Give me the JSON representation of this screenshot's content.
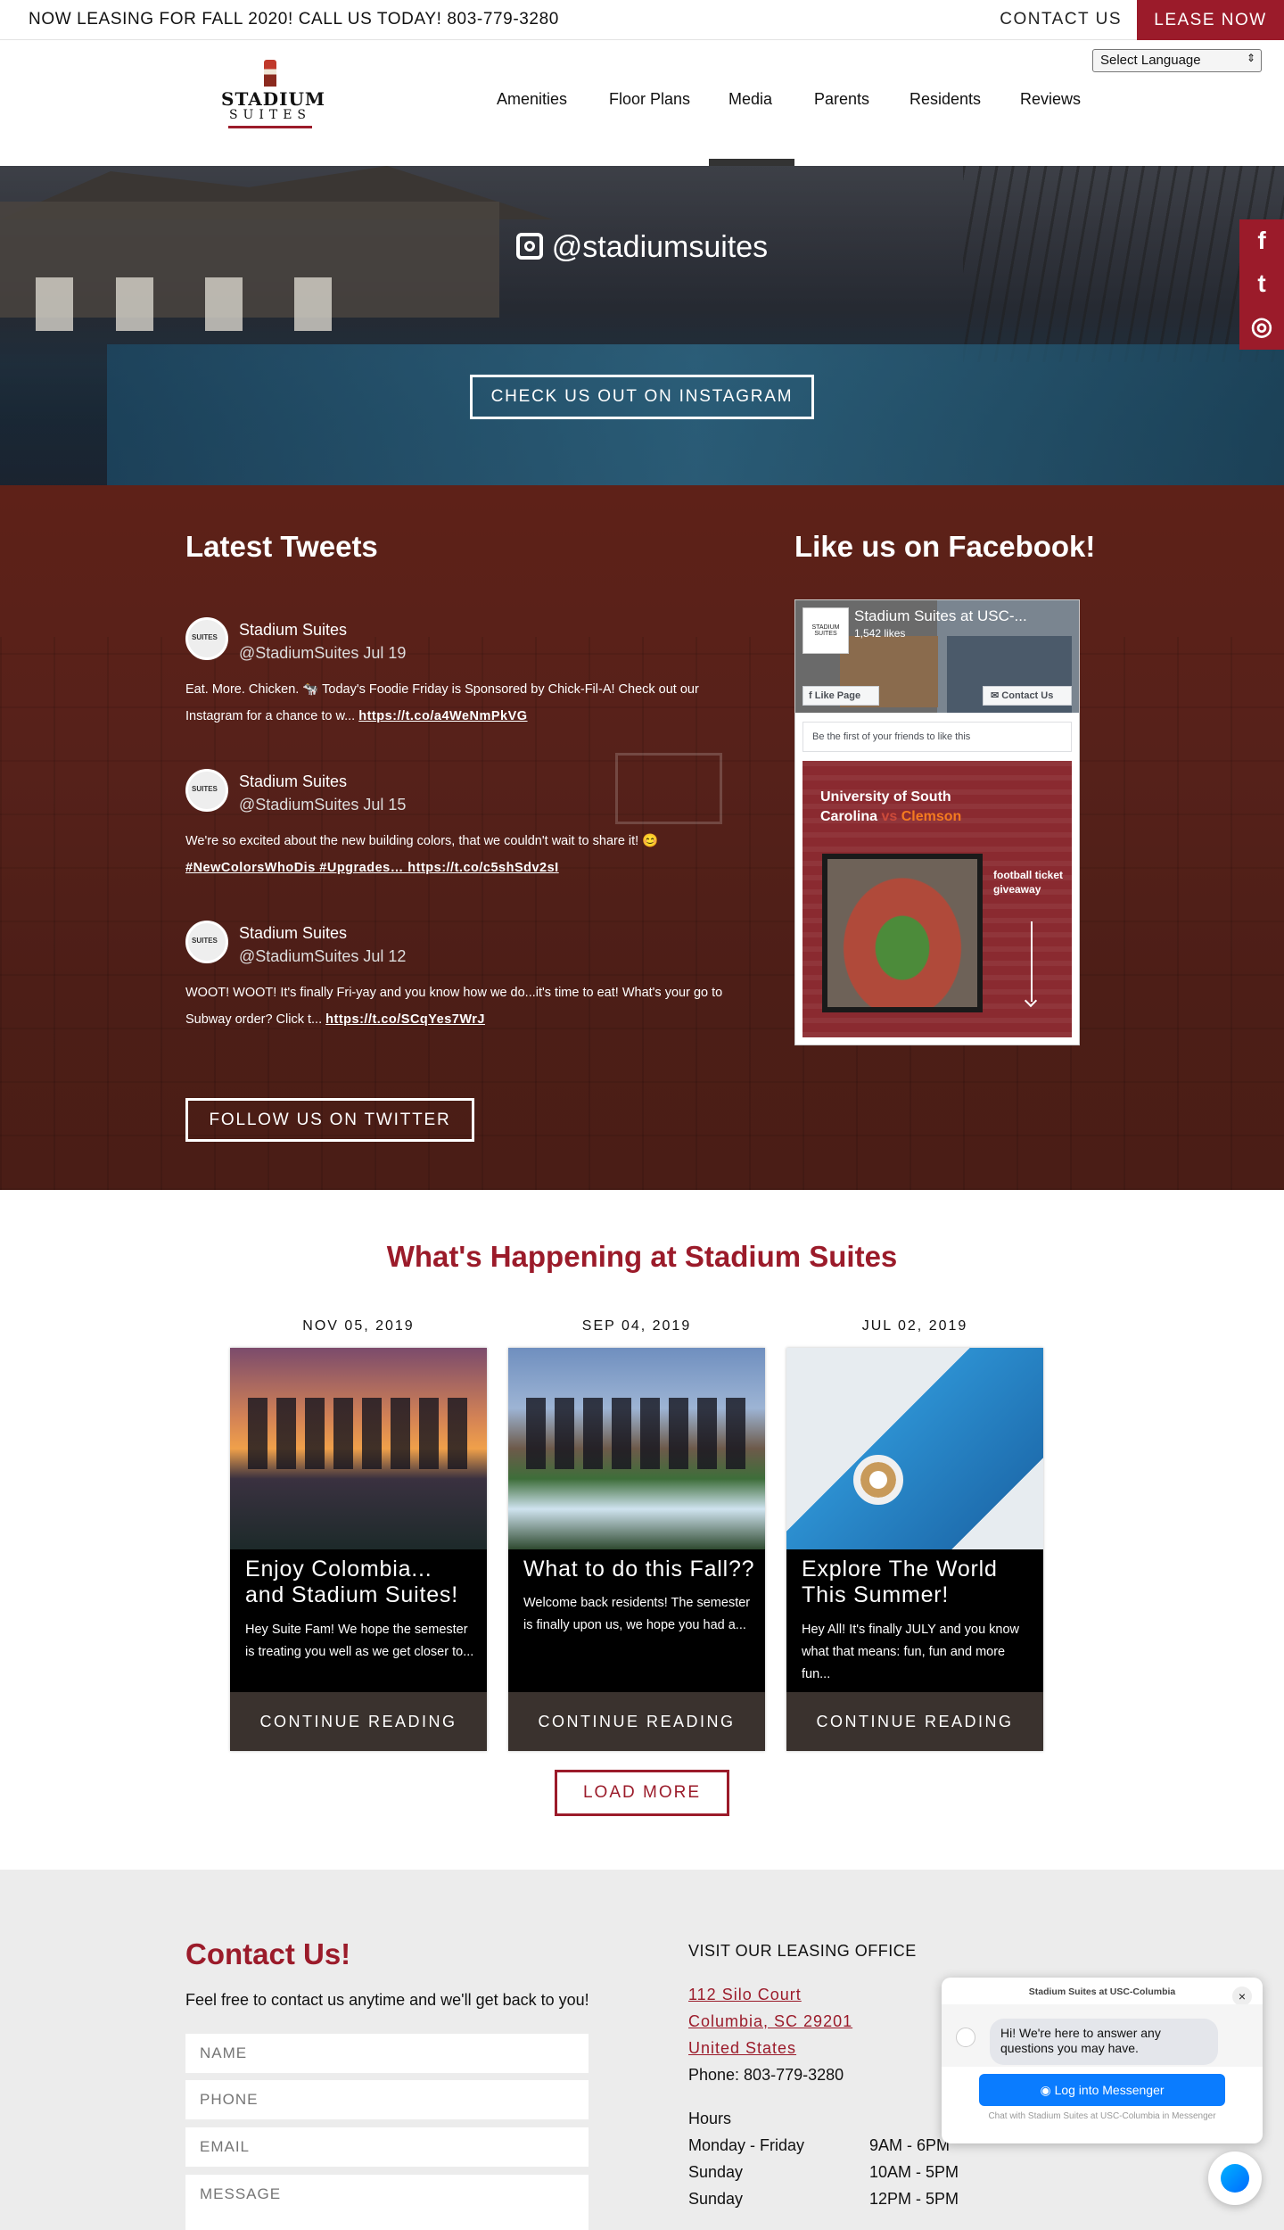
{
  "topbar": {
    "promo": "NOW LEASING FOR FALL 2020! CALL US TODAY! 803-779-3280",
    "contact_label": "CONTACT US",
    "lease_label": "LEASE NOW"
  },
  "header": {
    "language_select": "Select Language",
    "logo_line1": "STADIUM",
    "logo_line2": "SUITES",
    "nav": [
      "Amenities",
      "Floor Plans",
      "Media",
      "Parents",
      "Residents",
      "Reviews"
    ],
    "active_nav": "Media"
  },
  "hero": {
    "instagram_handle": "@stadiumsuites",
    "instagram_button": "CHECK US OUT ON INSTAGRAM"
  },
  "social_tab": {
    "icons": [
      "facebook-icon",
      "twitter-icon",
      "instagram-icon"
    ],
    "glyphs": [
      "f",
      "t",
      "◎"
    ]
  },
  "tweets": {
    "title": "Latest Tweets",
    "items": [
      {
        "name": "Stadium Suites",
        "handle": "@StadiumSuites Jul 19",
        "text": "Eat. More. Chicken. 🐄 Today's Foodie Friday is Sponsored by Chick-Fil-A! Check out our Instagram for a chance to w...",
        "link": "https://t.co/a4WeNmPkVG"
      },
      {
        "name": "Stadium Suites",
        "handle": "@StadiumSuites Jul 15",
        "text": "We're so excited about the new building colors, that we couldn't wait to share it! 😊",
        "link": "#NewColorsWhoDis #Upgrades… https://t.co/c5shSdv2sI"
      },
      {
        "name": "Stadium Suites",
        "handle": "@StadiumSuites Jul 12",
        "text": "WOOT! WOOT! It's finally Fri-yay and you know how we do...it's time to eat! What's your go to Subway order? Click t...",
        "link": "https://t.co/SCqYes7WrJ"
      }
    ],
    "follow_button": "FOLLOW US ON TWITTER"
  },
  "facebook": {
    "title": "Like us on Facebook!",
    "page_name": "Stadium Suites at USC-...",
    "likes": "1,542 likes",
    "like_button": "Like Page",
    "contact_button": "Contact Us",
    "friends_text": "Be the first of your friends to like this",
    "post_line1": "University of South",
    "post_line2a": "Carolina",
    "post_vs": "vs",
    "post_line2b": "Clemson",
    "post_giveaway": "football ticket giveaway",
    "page_logo_text": "STADIUM SUITES"
  },
  "happening": {
    "title": "What's Happening at Stadium Suites",
    "posts": [
      {
        "date": "NOV 05, 2019",
        "title": "Enjoy Colombia... and Stadium Suites!",
        "excerpt": "Hey Suite Fam!  We hope the semester is treating you well as we get closer to...",
        "button": "CONTINUE READING"
      },
      {
        "date": "SEP 04, 2019",
        "title": "What to do this Fall??",
        "excerpt": "Welcome back residents! The semester is finally upon us, we hope you had a...",
        "button": "CONTINUE READING"
      },
      {
        "date": "JUL 02, 2019",
        "title": "Explore The World This Summer!",
        "excerpt": "Hey All! It's finally JULY and you know what that means: fun, fun and more fun...",
        "button": "CONTINUE READING"
      }
    ],
    "load_more": "LOAD MORE"
  },
  "contact": {
    "title": "Contact Us!",
    "subtitle": "Feel free to contact us anytime and we'll get back to you!",
    "placeholders": {
      "name": "NAME",
      "phone": "PHONE",
      "email": "EMAIL",
      "message": "MESSAGE"
    },
    "office_title": "VISIT OUR LEASING OFFICE",
    "address_line1": "112 Silo Court",
    "address_line2": "Columbia, SC 29201",
    "address_line3": "United States",
    "phone": "Phone: 803-779-3280",
    "hours_title": "Hours",
    "hours": [
      {
        "day": "Monday - Friday",
        "time": "9AM - 6PM"
      },
      {
        "day": "Sunday",
        "time": "10AM - 5PM"
      },
      {
        "day": "Sunday",
        "time": "12PM - 5PM"
      }
    ]
  },
  "messenger": {
    "title": "Stadium Suites at USC-Columbia",
    "greeting": "Hi! We're here to answer any questions you may have.",
    "button": "Log into Messenger",
    "footer": "Chat with Stadium Suites at USC-Columbia in Messenger",
    "close_glyph": "×"
  },
  "colors": {
    "brand_red": "#9b1b2a",
    "tweets_bg": "#56211a",
    "messenger_blue": "#0a7cff"
  }
}
